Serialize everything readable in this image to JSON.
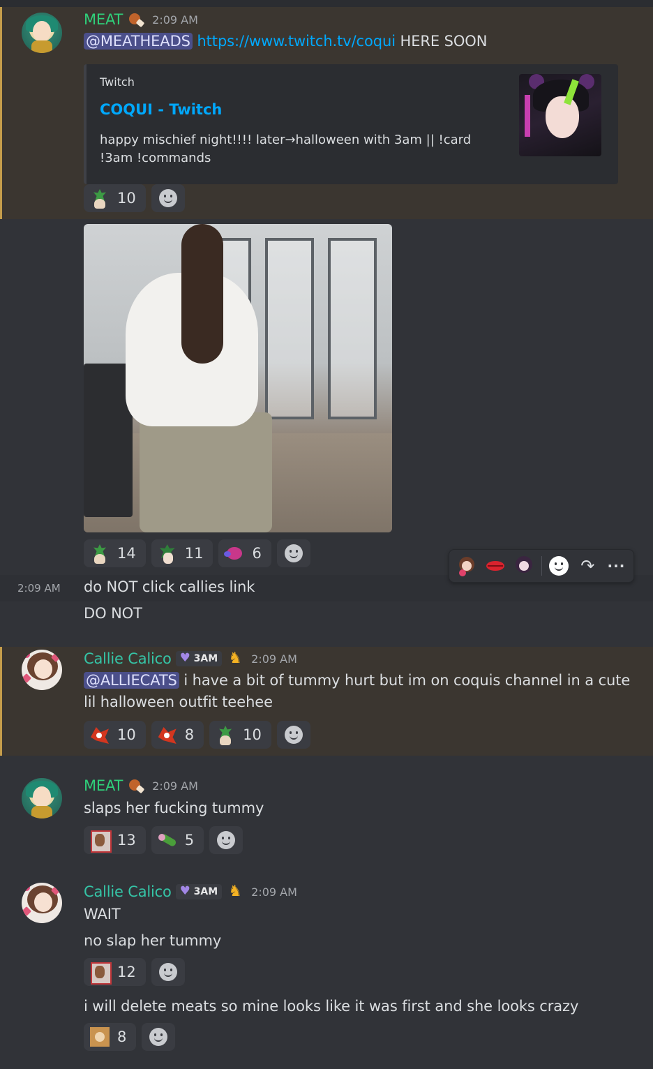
{
  "messages": {
    "m1": {
      "username": "MEAT",
      "timestamp": "2:09 AM",
      "mention": "@MEATHEADS",
      "link": "https://www.twitch.tv/coqui",
      "trailing": " HERE SOON",
      "embed": {
        "provider": "Twitch",
        "title": "COQUI - Twitch",
        "description": "happy mischief night!!!! later→halloween with 3am || !card !3am !commands"
      },
      "reactions": [
        {
          "emoji": "goblin-emoji",
          "count": "10"
        }
      ]
    },
    "m2": {
      "reactions": [
        {
          "emoji": "goblin-emoji",
          "count": "14"
        },
        {
          "emoji": "goblin-girl-emoji",
          "count": "11"
        },
        {
          "emoji": "pink-blob-emoji",
          "count": "6"
        }
      ]
    },
    "m3": {
      "timestamp": "2:09 AM",
      "line1": "do NOT click callies link",
      "line2": "DO NOT"
    },
    "m4": {
      "username": "Callie Calico",
      "role": "3AM",
      "timestamp": "2:09 AM",
      "mention": "@ALLIECATS",
      "text1": " i have a bit of tummy hurt but im on coquis channel in a cute",
      "text2": "lil halloween outfit teehee",
      "reactions": [
        {
          "emoji": "fire-bird-emoji",
          "count": "10"
        },
        {
          "emoji": "fire-bird-emoji",
          "count": "8"
        },
        {
          "emoji": "goblin-emoji",
          "count": "10"
        }
      ]
    },
    "m5": {
      "username": "MEAT",
      "timestamp": "2:09 AM",
      "text": "slaps her fucking tummy",
      "reactions": [
        {
          "emoji": "man-face-emoji",
          "count": "13"
        },
        {
          "emoji": "cucumber-emoji",
          "count": "5"
        }
      ]
    },
    "m6": {
      "username": "Callie Calico",
      "role": "3AM",
      "timestamp": "2:09 AM",
      "line1": "WAIT",
      "line2": "no slap her tummy",
      "reactions1": [
        {
          "emoji": "man-face-emoji",
          "count": "12"
        }
      ],
      "line3": "i will delete meats so mine looks like it was first and she looks crazy",
      "reactions2": [
        {
          "emoji": "dog-emoji",
          "count": "8"
        }
      ]
    }
  },
  "toolbar": {
    "icons": [
      "girl-emoji",
      "lips-emoji",
      "skull-girl-emoji",
      "add-reaction-icon",
      "reply-icon",
      "more-icon"
    ]
  },
  "colors": {
    "background": "#313338",
    "mention_highlight": "#3b3630",
    "mention_bar": "#c59d4b",
    "meat_name": "#2fd07a",
    "callie_name": "#35c5a7",
    "link": "#00a8fc"
  }
}
